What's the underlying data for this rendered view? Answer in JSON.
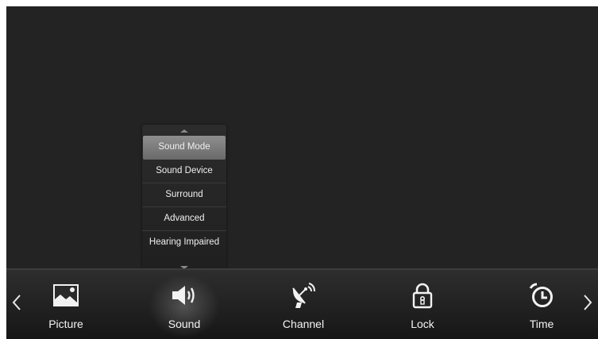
{
  "submenu": {
    "items": [
      {
        "label": "Sound Mode",
        "selected": true
      },
      {
        "label": "Sound Device",
        "selected": false
      },
      {
        "label": "Surround",
        "selected": false
      },
      {
        "label": "Advanced",
        "selected": false
      },
      {
        "label": "Hearing Impaired",
        "selected": false
      }
    ]
  },
  "menu_bar": {
    "items": [
      {
        "label": "Picture",
        "icon": "picture-icon"
      },
      {
        "label": "Sound",
        "icon": "speaker-icon",
        "active": true
      },
      {
        "label": "Channel",
        "icon": "satellite-dish-icon"
      },
      {
        "label": "Lock",
        "icon": "lock-icon"
      },
      {
        "label": "Time",
        "icon": "alarm-clock-icon"
      }
    ]
  },
  "colors": {
    "screen_background": "#232323",
    "selected_item": "#7c7c7c",
    "text": "#f0f0f0"
  }
}
